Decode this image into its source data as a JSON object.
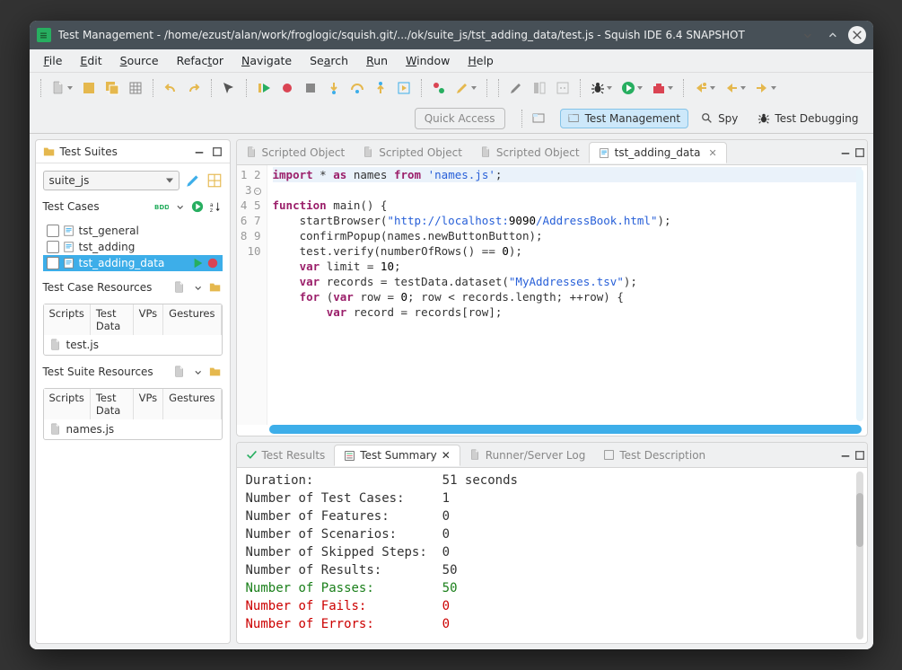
{
  "titlebar": {
    "title": "Test Management - /home/ezust/alan/work/froglogic/squish.git/.../ok/suite_js/tst_adding_data/test.js - Squish IDE 6.4 SNAPSHOT"
  },
  "menu": [
    "File",
    "Edit",
    "Source",
    "Refactor",
    "Navigate",
    "Search",
    "Run",
    "Window",
    "Help"
  ],
  "quick_access_placeholder": "Quick Access",
  "perspectives": [
    {
      "name": "test-management",
      "label": "Test Management",
      "active": true
    },
    {
      "name": "spy",
      "label": "Spy",
      "active": false
    },
    {
      "name": "test-debugging",
      "label": "Test Debugging",
      "active": false
    }
  ],
  "test_suites": {
    "view_title": "Test Suites",
    "suite_selected": "suite_js",
    "test_cases_label": "Test Cases",
    "test_cases": [
      {
        "name": "tst_general",
        "selected": false
      },
      {
        "name": "tst_adding",
        "selected": false
      },
      {
        "name": "tst_adding_data",
        "selected": true
      }
    ],
    "test_case_resources_label": "Test Case Resources",
    "tcr_tabs": [
      "Scripts",
      "Test Data",
      "VPs",
      "Gestures"
    ],
    "tcr_file": "test.js",
    "test_suite_resources_label": "Test Suite Resources",
    "tsr_tabs": [
      "Scripts",
      "Test Data",
      "VPs",
      "Gestures"
    ],
    "tsr_file": "names.js"
  },
  "editor": {
    "inactive_tab": "Scripted Object",
    "active_tab": "tst_adding_data",
    "code_lines": [
      {
        "n": 1,
        "raw": "import * as names from 'names.js';"
      },
      {
        "n": 2,
        "raw": ""
      },
      {
        "n": 3,
        "raw": "function main() {",
        "fold": true
      },
      {
        "n": 4,
        "raw": "    startBrowser(\"http://localhost:9090/AddressBook.html\");"
      },
      {
        "n": 5,
        "raw": "    confirmPopup(names.newButtonButton);"
      },
      {
        "n": 6,
        "raw": "    test.verify(numberOfRows() == 0);"
      },
      {
        "n": 7,
        "raw": "    var limit = 10;"
      },
      {
        "n": 8,
        "raw": "    var records = testData.dataset(\"MyAddresses.tsv\");"
      },
      {
        "n": 9,
        "raw": "    for (var row = 0; row < records.length; ++row) {"
      },
      {
        "n": 10,
        "raw": "        var record = records[row];"
      }
    ]
  },
  "bottom": {
    "tabs": [
      "Test Results",
      "Test Summary",
      "Runner/Server Log",
      "Test Description"
    ],
    "active": 1,
    "summary_rows": [
      {
        "k": "Duration:",
        "v": "51 seconds",
        "cls": ""
      },
      {
        "k": "Number of Test Cases:",
        "v": "1",
        "cls": ""
      },
      {
        "k": "Number of Features:",
        "v": "0",
        "cls": ""
      },
      {
        "k": "Number of Scenarios:",
        "v": "0",
        "cls": ""
      },
      {
        "k": "Number of Skipped Steps:",
        "v": "0",
        "cls": ""
      },
      {
        "k": "Number of Results:",
        "v": "50",
        "cls": ""
      },
      {
        "k": "Number of Passes:",
        "v": "50",
        "cls": "green"
      },
      {
        "k": "Number of Fails:",
        "v": "0",
        "cls": "red"
      },
      {
        "k": "Number of Errors:",
        "v": "0",
        "cls": "red"
      }
    ]
  }
}
